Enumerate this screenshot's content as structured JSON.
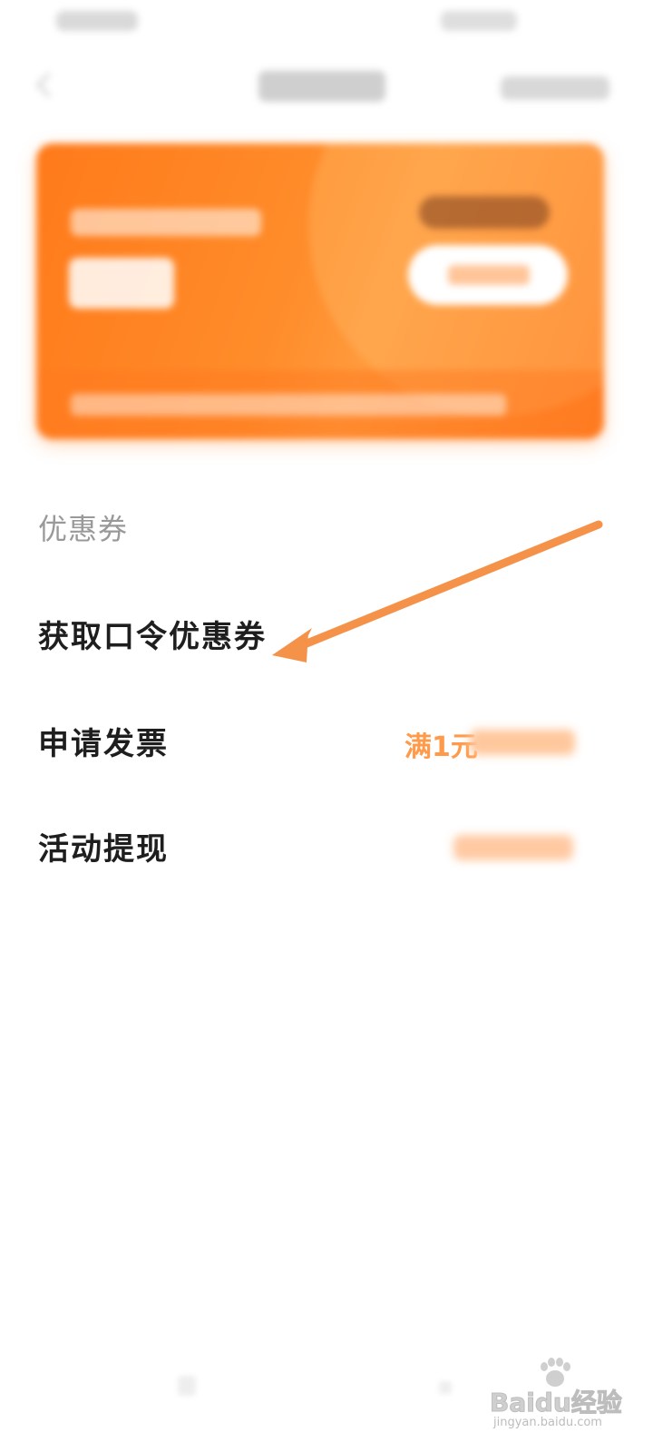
{
  "section": {
    "header": "优惠券"
  },
  "menu": {
    "coupon_label": "获取口令优惠券",
    "invoice_label": "申请发票",
    "invoice_value": "满1元",
    "withdraw_label": "活动提现"
  },
  "colors": {
    "accent": "#ff8a2a",
    "card_start": "#ff7a1a",
    "card_end": "#ff9a3c",
    "arrow": "#f5924a",
    "invoice_value": "#ff9a4a"
  },
  "icons": {
    "back": "chevron-left-icon",
    "watermark": "baidu-paw-icon"
  },
  "watermark": {
    "brand": "Baidu经验",
    "url": "jingyan.baidu.com"
  }
}
